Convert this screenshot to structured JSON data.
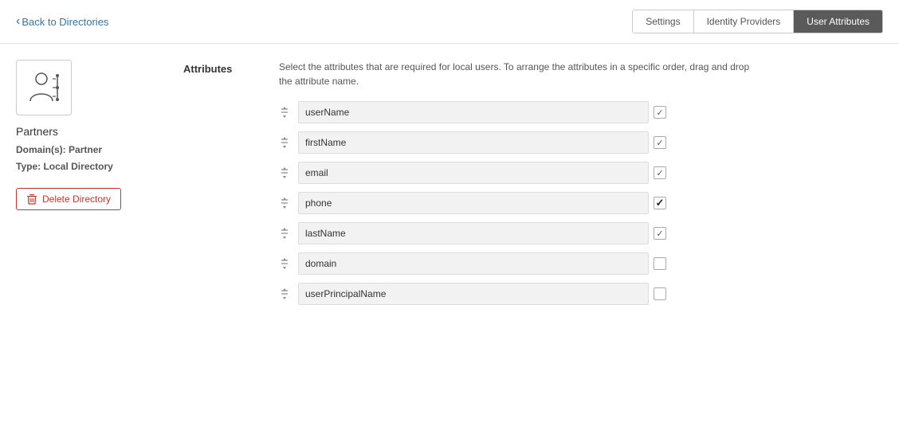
{
  "header": {
    "back_label": "Back to Directories",
    "tabs": [
      {
        "id": "settings",
        "label": "Settings",
        "active": false
      },
      {
        "id": "identity-providers",
        "label": "Identity Providers",
        "active": false
      },
      {
        "id": "user-attributes",
        "label": "User Attributes",
        "active": true
      }
    ]
  },
  "sidebar": {
    "directory_name": "Partners",
    "domains_label": "Domain(s):",
    "domains_value": "Partner",
    "type_label": "Type:",
    "type_value": "Local Directory",
    "delete_button": "Delete Directory"
  },
  "content": {
    "attributes_label": "Attributes",
    "description": "Select the attributes that are required for local users. To arrange the attributes in a specific order, drag and drop the attribute name.",
    "attributes": [
      {
        "name": "userName",
        "checked": "light"
      },
      {
        "name": "firstName",
        "checked": "light"
      },
      {
        "name": "email",
        "checked": "light"
      },
      {
        "name": "phone",
        "checked": "dark"
      },
      {
        "name": "lastName",
        "checked": "light"
      },
      {
        "name": "domain",
        "checked": "none"
      },
      {
        "name": "userPrincipalName",
        "checked": "none"
      }
    ]
  }
}
